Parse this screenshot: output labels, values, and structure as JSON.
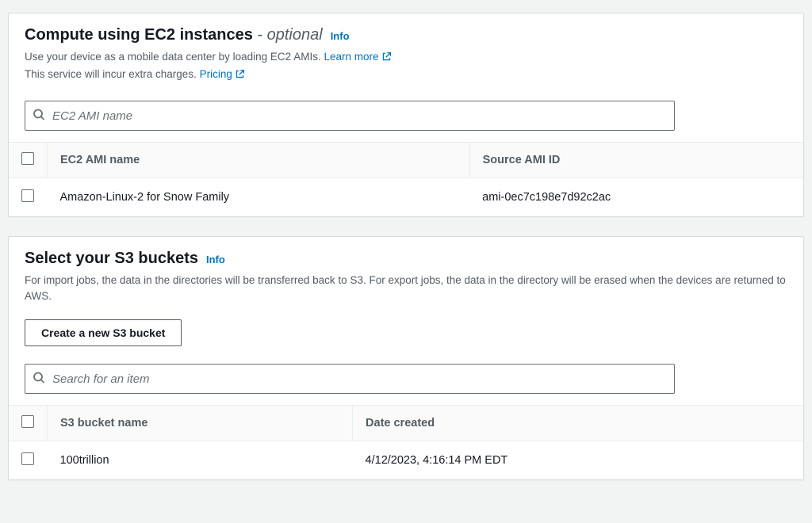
{
  "ec2": {
    "title": "Compute using EC2 instances",
    "optional": " - optional",
    "info": "Info",
    "desc1a": "Use your device as a mobile data center by loading EC2 AMIs. ",
    "learn_more": "Learn more",
    "desc2a": "This service will incur extra charges. ",
    "pricing": "Pricing",
    "search_placeholder": "EC2 AMI name",
    "columns": {
      "name": "EC2 AMI name",
      "source": "Source AMI ID"
    },
    "rows": [
      {
        "name": "Amazon-Linux-2 for Snow Family",
        "source": "ami-0ec7c198e7d92c2ac"
      }
    ]
  },
  "s3": {
    "title": "Select your S3 buckets",
    "info": "Info",
    "desc": "For import jobs, the data in the directories will be transferred back to S3. For export jobs, the data in the directory will be erased when the devices are returned to AWS.",
    "create_btn": "Create a new S3 bucket",
    "search_placeholder": "Search for an item",
    "columns": {
      "name": "S3 bucket name",
      "date": "Date created"
    },
    "rows": [
      {
        "name": "100trillion",
        "date": "4/12/2023, 4:16:14 PM EDT"
      }
    ]
  }
}
